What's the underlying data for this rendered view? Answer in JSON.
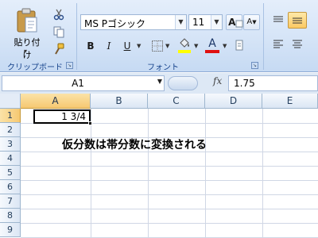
{
  "ribbon": {
    "clipboard": {
      "label": "クリップボード",
      "paste_label": "貼り付け",
      "paste_arrow": "▾",
      "icons": [
        "clipboard-icon",
        "scissors-icon",
        "copy-icon",
        "format-painter-icon"
      ]
    },
    "font": {
      "label": "フォント",
      "font_name": "MS Pゴシック",
      "font_size": "11",
      "grow_font": "A",
      "shrink_font": "A",
      "bold": "B",
      "italic": "I",
      "underline": "U",
      "font_color_letter": "A",
      "font_color": "#e01010",
      "fill_color": "#ffff00"
    },
    "alignment": {
      "icons": [
        "align-top-icon",
        "align-middle-icon",
        "align-left-icon",
        "align-center-icon"
      ]
    },
    "launcher_glyph": "↘"
  },
  "formula_bar": {
    "name_box": "A1",
    "fx": "fx",
    "formula": "1.75"
  },
  "sheet": {
    "columns": [
      "A",
      "B",
      "C",
      "D",
      "E"
    ],
    "rows": [
      "1",
      "2",
      "3",
      "4",
      "5",
      "6",
      "7",
      "8",
      "9"
    ],
    "selected_column": "A",
    "selected_row": "1",
    "active_cell_value": "1 3/4",
    "note": "仮分数は帯分数に変換される"
  }
}
